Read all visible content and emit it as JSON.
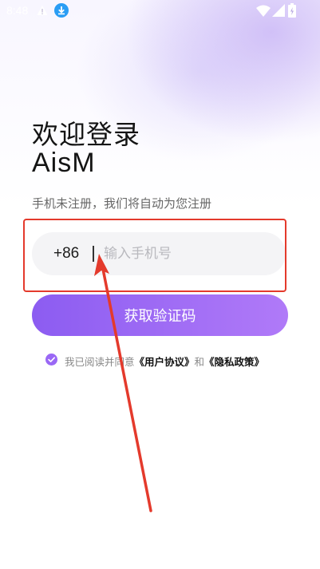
{
  "status_bar": {
    "time": "8:48",
    "icons": [
      "warning-icon",
      "download-icon",
      "wifi-icon",
      "signal-icon",
      "battery-icon"
    ]
  },
  "login": {
    "title_line1": "欢迎登录",
    "title_line2": "AisM",
    "subtitle": "手机未注册，我们将自动为您注册",
    "country_code": "+86",
    "phone_placeholder": "输入手机号",
    "phone_value": "",
    "get_code_button": "获取验证码"
  },
  "agreement": {
    "prefix": "我已阅读并同意",
    "user_agreement": "《用户协议》",
    "and": "和",
    "privacy_policy": "《隐私政策》",
    "checked": true
  },
  "colors": {
    "accent": "#9a68f5",
    "annotation": "#e43a2c"
  }
}
